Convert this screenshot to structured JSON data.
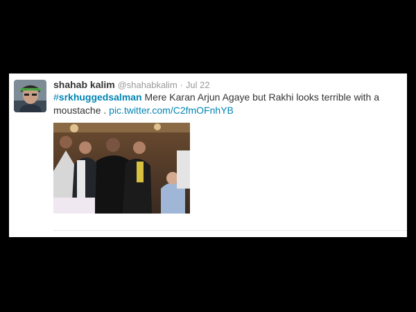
{
  "tweet": {
    "author_name": "shahab kalim",
    "author_handle": "@shahabkalim",
    "separator": "·",
    "date": "Jul 22",
    "hashtag_symbol": "#",
    "hashtag_text": "srkhuggedsalman",
    "text": " Mere Karan Arjun Agaye but Rakhi looks terrible with a moustache . ",
    "link": "pic.twitter.com/C2fmOFnhYB"
  },
  "colors": {
    "background": "#000000",
    "card": "#ffffff",
    "link": "#0084b4",
    "name": "#333333",
    "meta": "#999999"
  }
}
